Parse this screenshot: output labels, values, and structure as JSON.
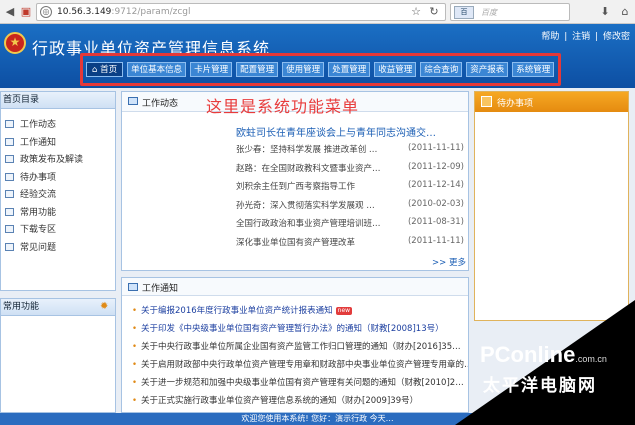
{
  "browser": {
    "url_host": "10.56.3.149",
    "url_path": ":9712/param/zcgl",
    "search_placeholder": "百度",
    "search_engine": "百",
    "icons": [
      "back-arrow-icon",
      "security-icon",
      "globe-icon",
      "star-icon",
      "refresh-icon",
      "download-icon",
      "home-icon"
    ]
  },
  "header": {
    "title": "行政事业单位资产管理信息系统",
    "links": [
      "帮助",
      "注销",
      "修改密"
    ],
    "separator": "|"
  },
  "menu": {
    "items": [
      "首页",
      "单位基本信息",
      "卡片管理",
      "配置管理",
      "使用管理",
      "处置管理",
      "收益管理",
      "综合查询",
      "资产报表",
      "系统管理"
    ],
    "outline_color": "#e53838"
  },
  "annotation": "这里是系统功能菜单",
  "left": {
    "heading": "首页目录",
    "items": [
      "工作动态",
      "工作通知",
      "政策发布及解读",
      "待办事项",
      "经验交流",
      "常用功能",
      "下载专区",
      "常见问题"
    ],
    "heading2": "常用功能"
  },
  "news": {
    "heading": "工作动态",
    "headline": "欧蛀司长在青年座谈会上与青年同志沟通交…",
    "rows": [
      {
        "title": "张少春：坚持科学发展 推进改革创 …",
        "date": "(2011-11-11)"
      },
      {
        "title": "赵路：在全国财政教科文暨事业资产…",
        "date": "(2011-12-09)"
      },
      {
        "title": "刘积余主任到广西考察指导工作",
        "date": "(2011-12-14)"
      },
      {
        "title": "孙光奇：深入贯彻落实科学发展观 …",
        "date": "(2010-02-03)"
      },
      {
        "title": "全国行政政治和事业资产管理培训班…",
        "date": "(2011-08-31)"
      },
      {
        "title": "深化事业单位国有资产管理改革",
        "date": "(2011-11-11)"
      }
    ],
    "more": ">> 更多"
  },
  "notice": {
    "heading": "工作通知",
    "badge": "new",
    "rows": [
      "关于编报2016年度行政事业单位资产统计报表通知",
      "关于印发《中央级事业单位国有资产管理暂行办法》的通知（财教[2008]13号）",
      "关于中央行政事业单位所属企业国有资产监管工作归口管理的通知（财办[2016]35…",
      "关于启用财政部中央行政单位资产管理专用章和财政部中央事业单位资产管理专用章的…",
      "关于进一步规范和加强中央级事业单位国有资产管理有关问题的通知（财教[2010]2…",
      "关于正式实施行政事业单位资产管理信息系统的通知（财办[2009]39号）"
    ]
  },
  "todo": {
    "heading": "待办事项"
  },
  "status": {
    "text": "欢迎您使用本系统! 您好：演示行政 今天…"
  },
  "watermark": {
    "logo": "PConline",
    "suffix": ".com.cn",
    "cn": "太平洋电脑网"
  }
}
